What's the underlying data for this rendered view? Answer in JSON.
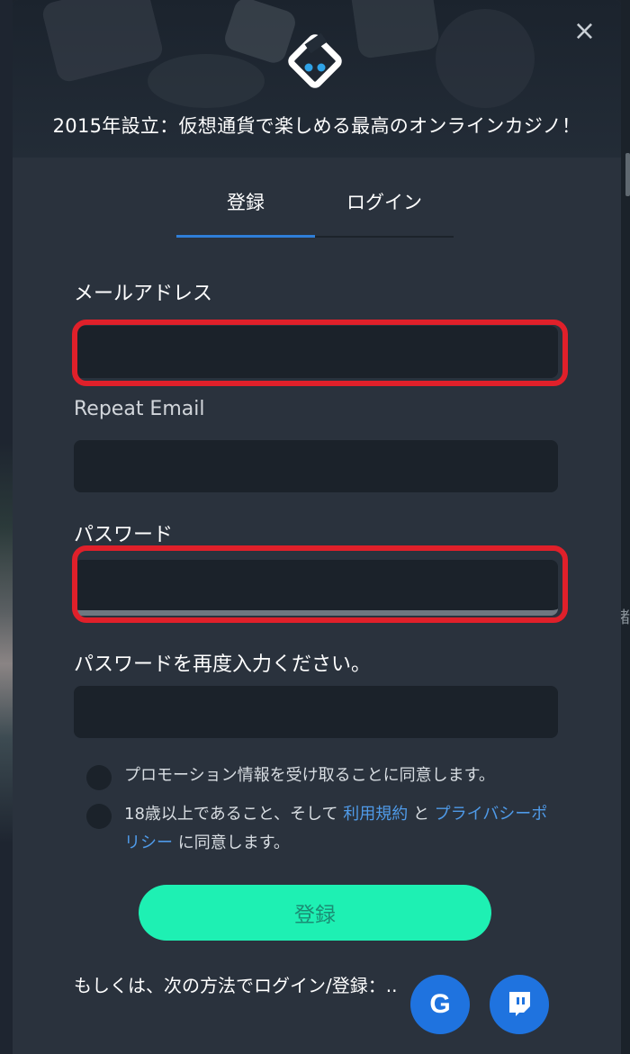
{
  "modal": {
    "tagline": "2015年設立：仮想通貨で楽しめる最高のオンラインカジノ！",
    "close_glyph": "×"
  },
  "tabs": [
    {
      "label": "登録",
      "active": true
    },
    {
      "label": "ログイン",
      "active": false
    }
  ],
  "form": {
    "email_label": "メールアドレス",
    "email_value": "",
    "repeat_email_label": "Repeat Email",
    "repeat_email_value": "",
    "password_label": "パスワード",
    "password_value": "",
    "repeat_password_label": "パスワードを再度入力ください。",
    "repeat_password_value": ""
  },
  "consents": {
    "promo_text": "プロモーション情報を受け取ることに同意します。",
    "age_prefix": "18歳以上であること、そして",
    "terms_link": "利用規約",
    "conjunction": "と",
    "privacy_link": "プライバシーポリシー",
    "age_suffix": "に同意します。"
  },
  "submit_label": "登録",
  "alt_login_text": "もしくは、次の方法でログイン/登録：..",
  "social": {
    "google_glyph": "G",
    "twitch_icon": "twitch-icon"
  },
  "colors": {
    "accent_button": "#1ef0b3",
    "link": "#4f9ae8",
    "tab_underline": "#2f7ed8",
    "highlight": "#e0202a",
    "social_bg": "#1f73df"
  },
  "background_edge_char": "賭"
}
